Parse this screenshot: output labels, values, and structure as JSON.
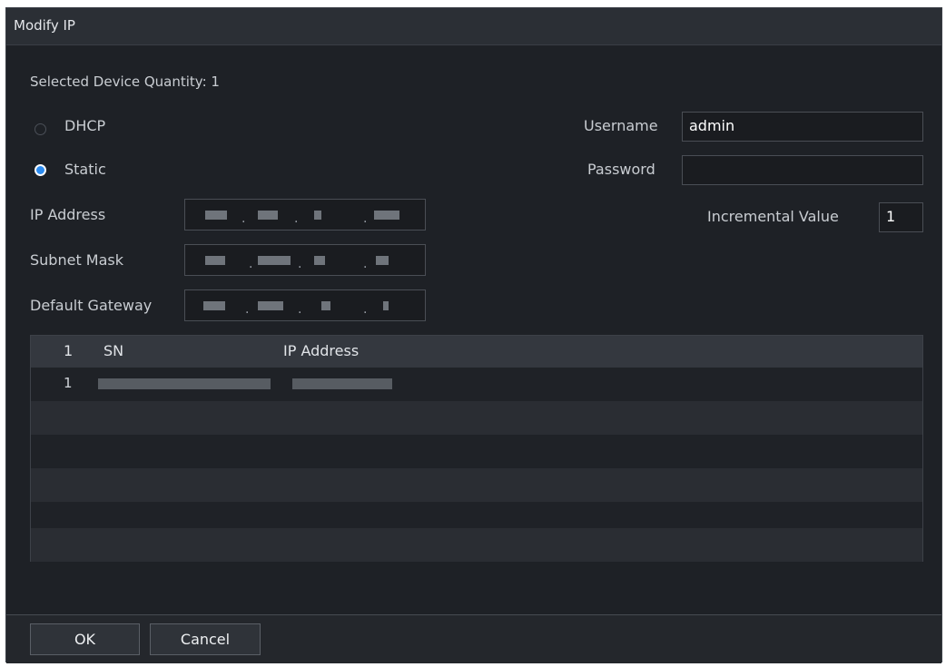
{
  "dialog": {
    "title": "Modify IP"
  },
  "form": {
    "selected_quantity": "Selected Device Quantity: 1",
    "mode": {
      "dhcp_label": "DHCP",
      "static_label": "Static",
      "selected": "Static"
    },
    "username_label": "Username",
    "username_value": "admin",
    "password_label": "Password",
    "password_value": "",
    "incremental_label": "Incremental Value",
    "incremental_value": "1",
    "ip_address_label": "IP Address",
    "subnet_mask_label": "Subnet Mask",
    "default_gateway_label": "Default Gateway"
  },
  "table": {
    "columns": [
      "1",
      "SN",
      "IP Address"
    ],
    "rows": [
      {
        "index": "1"
      }
    ]
  },
  "footer": {
    "ok_label": "OK",
    "cancel_label": "Cancel"
  },
  "colors": {
    "accent": "#2d8cf0",
    "background": "#1e2126"
  }
}
